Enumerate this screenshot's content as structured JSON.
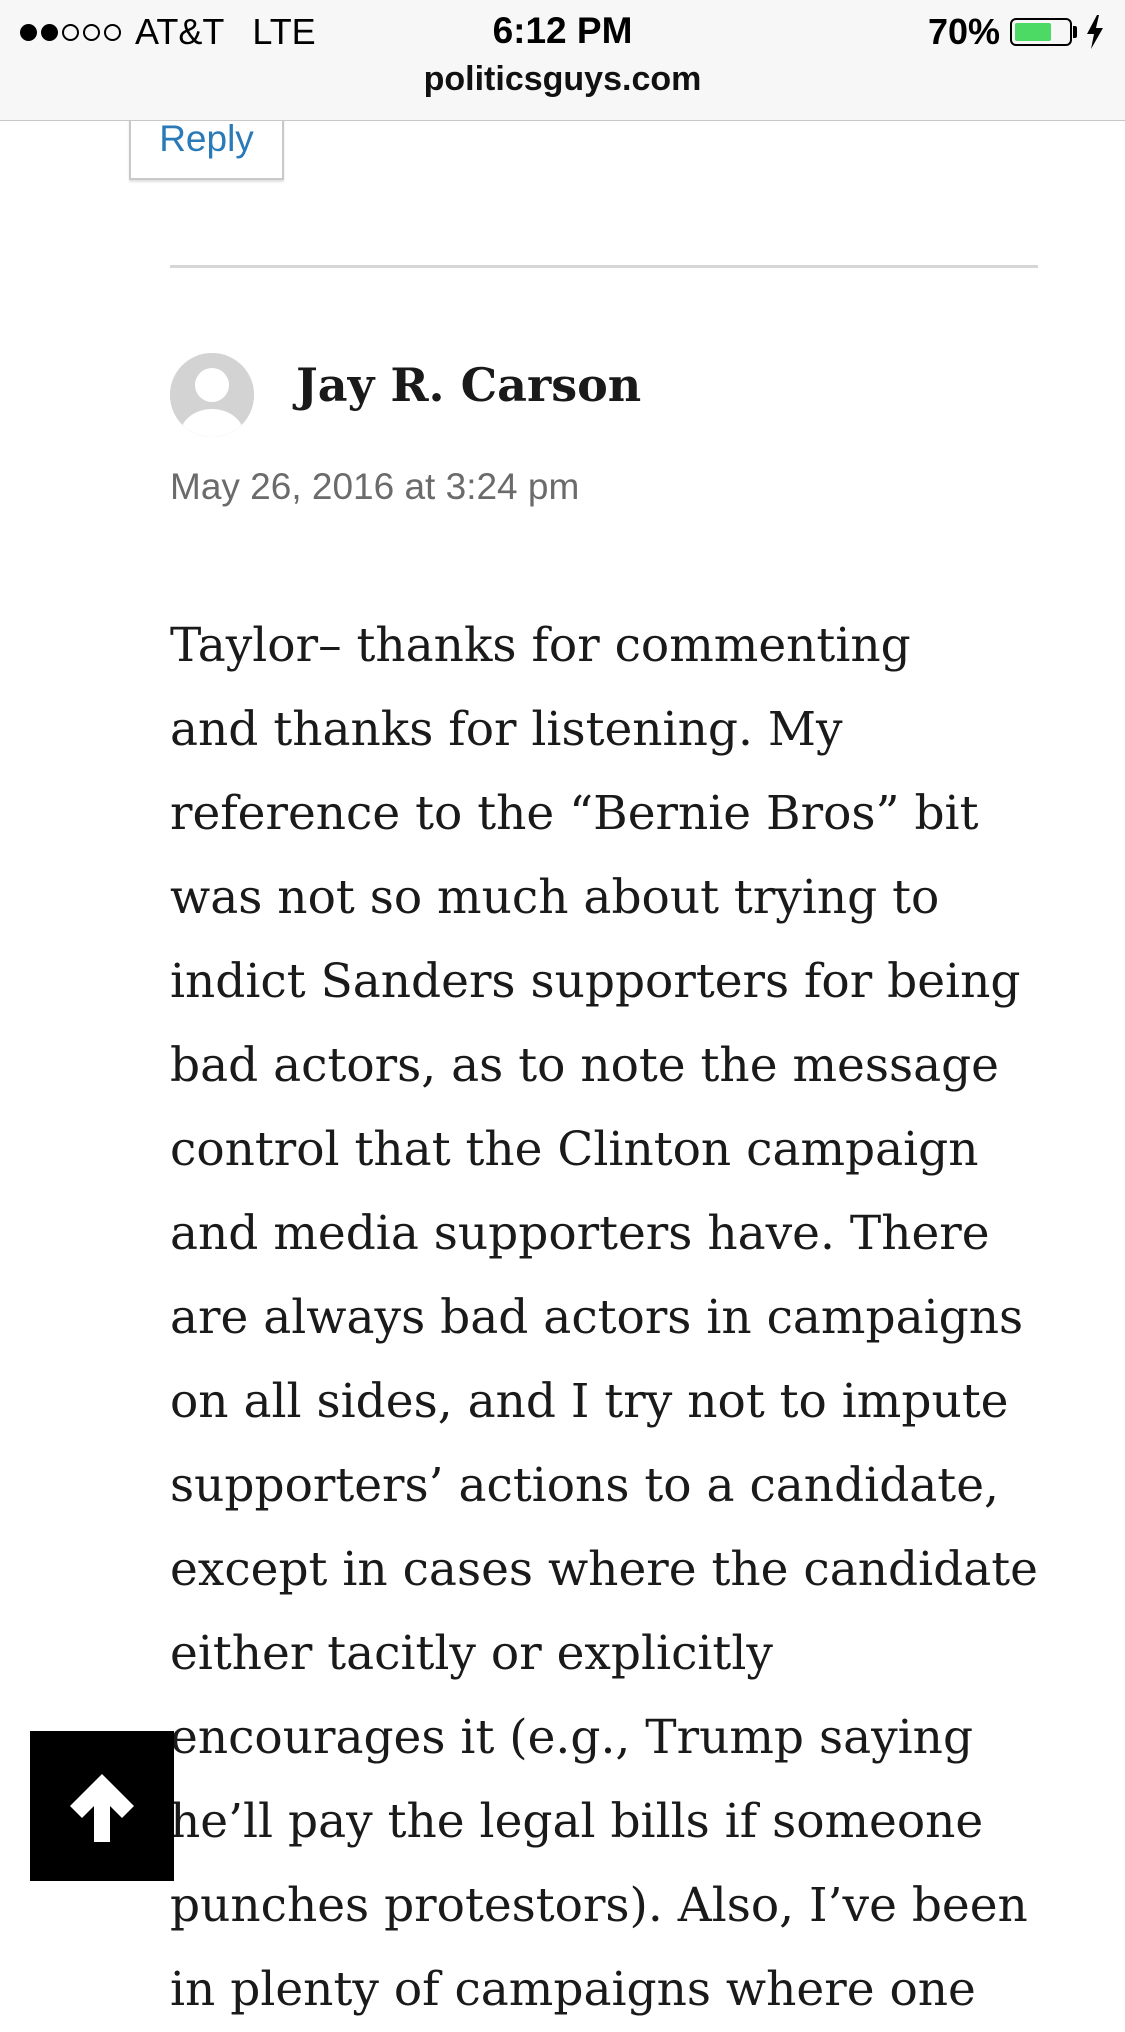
{
  "status_bar": {
    "carrier": "AT&T",
    "network": "LTE",
    "time": "6:12 PM",
    "battery_percent": "70%",
    "battery_level": 0.7,
    "url": "politicsguys.com"
  },
  "reply_button": {
    "label": "Reply"
  },
  "comment": {
    "author": "Jay R. Carson",
    "date": "May 26, 2016 at 3:24 pm",
    "lines": [
      "Taylor– thanks for commenting",
      "and thanks for listening. My",
      "reference to the “Bernie Bros” bit",
      "was not so much about trying to",
      "indict Sanders supporters for being",
      "bad actors, as to note the message",
      "control that the Clinton campaign",
      "and media supporters have. There",
      "are always bad actors in campaigns",
      "on all sides, and I try not to impute",
      "supporters’ actions to a candidate,",
      "except in cases where the candidate",
      "either tacitly or explicitly",
      "encourages it (e.g., Trump saying",
      "he’ll pay the legal bills if someone",
      "punches protestors). Also, I’ve been",
      "in plenty of campaigns where one"
    ]
  },
  "icons": {
    "scroll_top": "arrow-up-icon",
    "avatar": "default-avatar-icon",
    "charging": "bolt-icon"
  },
  "colors": {
    "link": "#2a7ab8",
    "battery": "#4cd964",
    "scroll_top_bg": "#000000"
  }
}
